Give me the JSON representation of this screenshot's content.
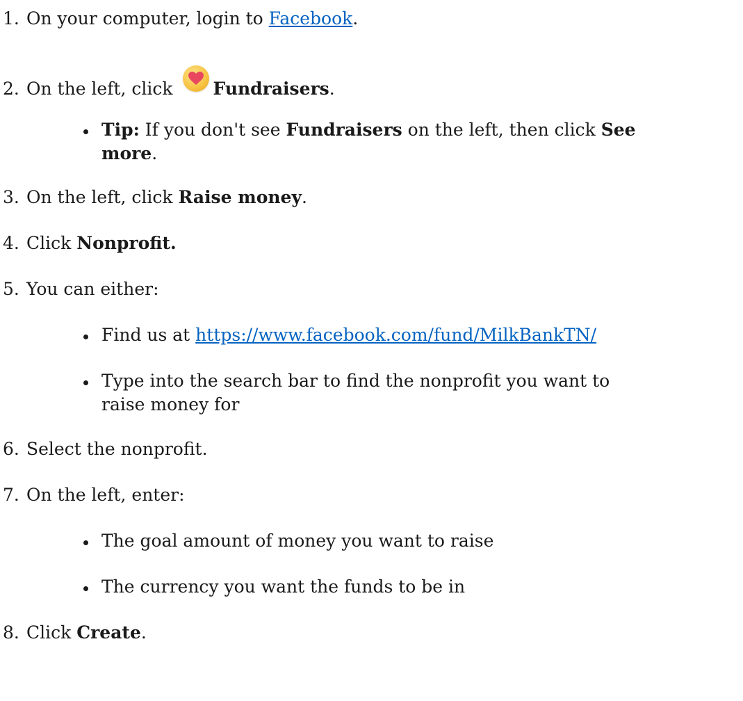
{
  "steps": [
    {
      "num": "1.",
      "pre": "On your computer, login to ",
      "link": "Facebook",
      "post": "."
    },
    {
      "num": "2.",
      "pre": "On the left, click ",
      "icon": "fundraisers-heart-icon",
      "bold": "Fundraisers",
      "post": "."
    },
    {
      "tip_label": "Tip:",
      "tip_pre": " If you don't see ",
      "tip_bold": "Fundraisers",
      "tip_mid": " on the left, then click ",
      "tip_bold2a": "See",
      "tip_bold2b": "more",
      "tip_post": "."
    },
    {
      "num": "3.",
      "pre": "On the left, click ",
      "bold": "Raise money",
      "post": "."
    },
    {
      "num": "4.",
      "pre": "Click ",
      "bold": "Nonprofit."
    },
    {
      "num": "5.",
      "pre": "You can either:"
    },
    {
      "bullet_pre": "Find us at ",
      "bullet_link": "https://www.facebook.com/fund/MilkBankTN/"
    },
    {
      "bullet_line1": "Type into the search bar to find the nonprofit you want to",
      "bullet_line2": "raise money for"
    },
    {
      "num": "6.",
      "pre": "Select the nonprofit."
    },
    {
      "num": "7.",
      "pre": "On the left, enter:"
    },
    {
      "bullet_text": "The goal amount of money you want to raise"
    },
    {
      "bullet_text": "The currency you want the funds to be in"
    },
    {
      "num": "8.",
      "pre": "Click ",
      "bold": "Create",
      "post": "."
    }
  ],
  "colors": {
    "text": "#1a1a1a",
    "link": "#0563c1",
    "icon_bg": "#f7c545",
    "heart": "#e8475f"
  }
}
